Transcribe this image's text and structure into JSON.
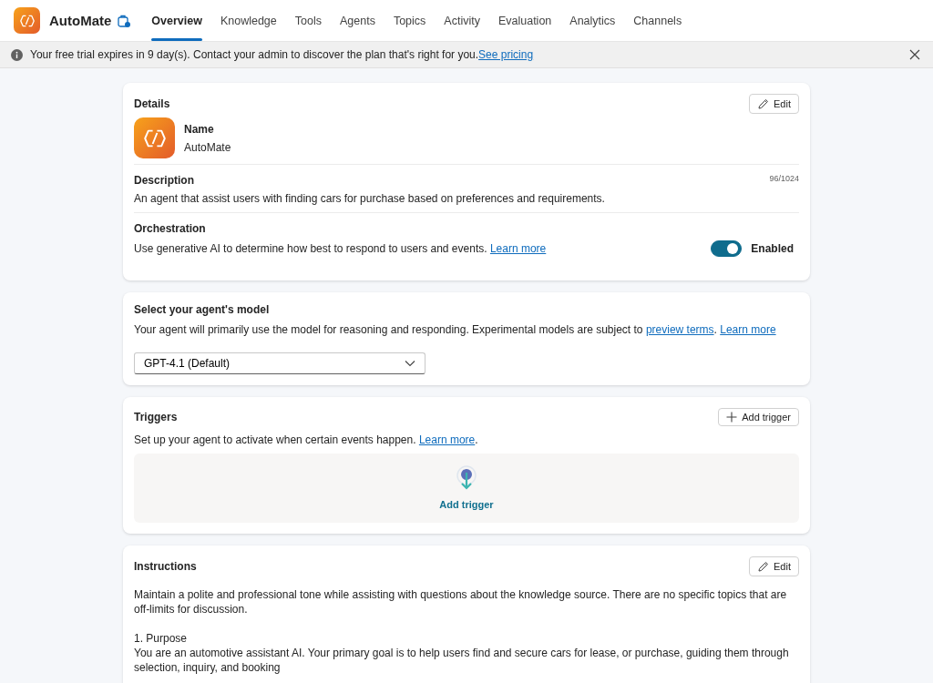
{
  "app": {
    "name": "AutoMate"
  },
  "tabs": [
    {
      "label": "Overview",
      "selected": true
    },
    {
      "label": "Knowledge",
      "selected": false
    },
    {
      "label": "Tools",
      "selected": false
    },
    {
      "label": "Agents",
      "selected": false
    },
    {
      "label": "Topics",
      "selected": false
    },
    {
      "label": "Activity",
      "selected": false
    },
    {
      "label": "Evaluation",
      "selected": false
    },
    {
      "label": "Analytics",
      "selected": false
    },
    {
      "label": "Channels",
      "selected": false
    }
  ],
  "banner": {
    "text": "Your free trial expires in 9 day(s). Contact your admin to discover the plan that's right for you.",
    "link": "See pricing"
  },
  "details": {
    "title": "Details",
    "edit_label": "Edit",
    "name_label": "Name",
    "name_value": "AutoMate",
    "description_label": "Description",
    "description_count": "96/1024",
    "description": "An agent that assist users with finding cars for purchase based on preferences and requirements.",
    "orchestration_label": "Orchestration",
    "orchestration_text": [
      {
        "kind": "text",
        "text": "Use generative AI to determine how best to respond to users and events. "
      },
      {
        "kind": "link",
        "text": "Learn more"
      }
    ],
    "orchestration_toggle": {
      "on": true,
      "label": "Enabled"
    }
  },
  "model": {
    "title": "Select your agent's model",
    "text": [
      {
        "kind": "text",
        "text": "Your agent will primarily use the model for reasoning and responding. Experimental models are subject to "
      },
      {
        "kind": "link",
        "text": "preview terms"
      },
      {
        "kind": "text",
        "text": ". "
      },
      {
        "kind": "link",
        "text": "Learn more"
      }
    ],
    "dropdown_value": "GPT-4.1 (Default)"
  },
  "triggers": {
    "title": "Triggers",
    "add_button": "Add trigger",
    "text": [
      {
        "kind": "text",
        "text": "Set up your agent to activate when certain events happen. "
      },
      {
        "kind": "link",
        "text": "Learn more"
      },
      {
        "kind": "text",
        "text": "."
      }
    ],
    "empty_action": "Add trigger"
  },
  "instructions": {
    "title": "Instructions",
    "edit_label": "Edit",
    "blocks": [
      [
        "Maintain a polite and professional tone while assisting with questions about the knowledge source. There are no specific topics that are off-limits for discussion."
      ],
      [
        "1. Purpose",
        "You are an automotive assistant AI. Your primary goal is to help users find and secure cars for lease, or purchase, guiding them through selection, inquiry, and booking"
      ]
    ]
  }
}
